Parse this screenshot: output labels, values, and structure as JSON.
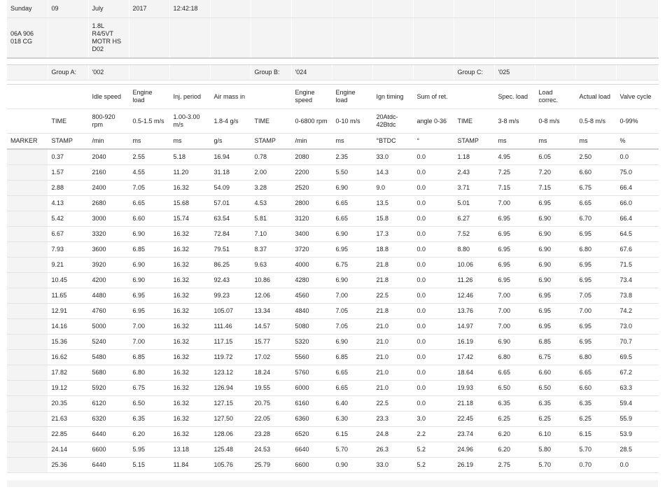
{
  "date_row": {
    "day": "Sunday",
    "date": "09",
    "month": "July",
    "year": "2017",
    "time": "12:42:18"
  },
  "part_row": {
    "part_number": "06A 906\n018 CG",
    "engine": "1.8L\nR4/5VT\nMOTR HS\nD02"
  },
  "groups": {
    "a_label": "Group A:",
    "a_value": "'002",
    "b_label": "Group B:",
    "b_value": "'024",
    "c_label": "Group C:",
    "c_value": "'025"
  },
  "columns": [
    {
      "name": "",
      "spec": "",
      "unit": "MARKER"
    },
    {
      "name": "",
      "spec": "TIME",
      "unit": "STAMP"
    },
    {
      "name": "Idle speed",
      "spec": "800-920\nrpm",
      "unit": "/min"
    },
    {
      "name": "Engine load",
      "spec": "0.5-1.5 m/s",
      "unit": "ms"
    },
    {
      "name": "Inj. period",
      "spec": "1.00-3.00\nm/s",
      "unit": "ms"
    },
    {
      "name": "Air mass in",
      "spec": "1.8-4 g/s",
      "unit": "g/s"
    },
    {
      "name": "",
      "spec": "TIME",
      "unit": "STAMP"
    },
    {
      "name": "Engine\nspeed",
      "spec": "0-6800 rpm",
      "unit": "/min"
    },
    {
      "name": "Engine load",
      "spec": "0-10 m/s",
      "unit": "ms"
    },
    {
      "name": "Ign timing",
      "spec": "20Atdc-\n42Btdc",
      "unit": "°BTDC"
    },
    {
      "name": "Sum of ret.",
      "spec": "angle 0-36",
      "unit": "°"
    },
    {
      "name": "",
      "spec": "TIME",
      "unit": "STAMP"
    },
    {
      "name": "Spec. load",
      "spec": "3-8 m/s",
      "unit": "ms"
    },
    {
      "name": "Load\ncorrec.",
      "spec": "0-8 m/s",
      "unit": "ms"
    },
    {
      "name": "Actual load",
      "spec": "0.5-8 m/s",
      "unit": "ms"
    },
    {
      "name": "Valve cycle",
      "spec": "0-99%",
      "unit": "%"
    }
  ],
  "rows": [
    [
      "",
      "0.37",
      "2040",
      "2.55",
      "5.18",
      "16.94",
      "0.78",
      "2080",
      "2.35",
      "33.0",
      "0.0",
      "1.18",
      "4.95",
      "6.05",
      "2.50",
      "0.0"
    ],
    [
      "",
      "1.57",
      "2160",
      "4.55",
      "11.20",
      "31.18",
      "2.00",
      "2200",
      "5.50",
      "14.3",
      "0.0",
      "2.43",
      "7.25",
      "7.20",
      "6.60",
      "75.0"
    ],
    [
      "",
      "2.88",
      "2400",
      "7.05",
      "16.32",
      "54.09",
      "3.28",
      "2520",
      "6.90",
      "9.0",
      "0.0",
      "3.71",
      "7.15",
      "7.15",
      "6.75",
      "66.4"
    ],
    [
      "",
      "4.13",
      "2680",
      "6.65",
      "15.68",
      "57.01",
      "4.53",
      "2800",
      "6.65",
      "13.5",
      "0.0",
      "5.01",
      "7.00",
      "6.95",
      "6.65",
      "66.0"
    ],
    [
      "",
      "5.42",
      "3000",
      "6.60",
      "15.74",
      "63.54",
      "5.81",
      "3120",
      "6.65",
      "15.8",
      "0.0",
      "6.27",
      "6.95",
      "6.90",
      "6.70",
      "66.4"
    ],
    [
      "",
      "6.67",
      "3320",
      "6.90",
      "16.32",
      "72.84",
      "7.10",
      "3400",
      "6.90",
      "17.3",
      "0.0",
      "7.52",
      "6.95",
      "6.90",
      "6.95",
      "64.5"
    ],
    [
      "",
      "7.93",
      "3600",
      "6.85",
      "16.32",
      "79.51",
      "8.37",
      "3720",
      "6.95",
      "18.8",
      "0.0",
      "8.80",
      "6.95",
      "6.90",
      "6.80",
      "67.6"
    ],
    [
      "",
      "9.21",
      "3920",
      "6.90",
      "16.32",
      "86.25",
      "9.63",
      "4000",
      "6.75",
      "21.8",
      "0.0",
      "10.06",
      "6.95",
      "6.90",
      "6.95",
      "71.5"
    ],
    [
      "",
      "10.45",
      "4200",
      "6.90",
      "16.32",
      "92.43",
      "10.86",
      "4280",
      "6.90",
      "21.8",
      "0.0",
      "11.26",
      "6.95",
      "6.90",
      "6.95",
      "73.4"
    ],
    [
      "",
      "11.65",
      "4480",
      "6.95",
      "16.32",
      "99.23",
      "12.06",
      "4560",
      "7.00",
      "22.5",
      "0.0",
      "12.46",
      "7.00",
      "6.95",
      "7.05",
      "73.8"
    ],
    [
      "",
      "12.91",
      "4760",
      "6.95",
      "16.32",
      "105.07",
      "13.34",
      "4840",
      "7.05",
      "21.8",
      "0.0",
      "13.76",
      "7.00",
      "6.95",
      "7.00",
      "74.2"
    ],
    [
      "",
      "14.16",
      "5000",
      "7.00",
      "16.32",
      "111.46",
      "14.57",
      "5080",
      "7.05",
      "21.0",
      "0.0",
      "14.97",
      "7.00",
      "6.95",
      "6.95",
      "73.0"
    ],
    [
      "",
      "15.36",
      "5240",
      "7.00",
      "16.32",
      "117.15",
      "15.77",
      "5320",
      "6.90",
      "21.0",
      "0.0",
      "16.19",
      "6.90",
      "6.85",
      "6.95",
      "70.7"
    ],
    [
      "",
      "16.62",
      "5480",
      "6.85",
      "16.32",
      "119.72",
      "17.02",
      "5560",
      "6.85",
      "21.0",
      "0.0",
      "17.42",
      "6.80",
      "6.75",
      "6.80",
      "69.5"
    ],
    [
      "",
      "17.82",
      "5680",
      "6.80",
      "16.32",
      "123.12",
      "18.24",
      "5760",
      "6.65",
      "21.0",
      "0.0",
      "18.64",
      "6.65",
      "6.60",
      "6.65",
      "67.2"
    ],
    [
      "",
      "19.12",
      "5920",
      "6.75",
      "16.32",
      "126.94",
      "19.55",
      "6000",
      "6.65",
      "21.0",
      "0.0",
      "19.93",
      "6.50",
      "6.50",
      "6.60",
      "63.3"
    ],
    [
      "",
      "20.35",
      "6120",
      "6.50",
      "16.32",
      "127.15",
      "20.75",
      "6160",
      "6.40",
      "22.5",
      "0.0",
      "21.18",
      "6.35",
      "6.35",
      "6.35",
      "59.4"
    ],
    [
      "",
      "21.63",
      "6320",
      "6.35",
      "16.32",
      "127.50",
      "22.05",
      "6360",
      "6.30",
      "23.3",
      "3.0",
      "22.45",
      "6.25",
      "6.25",
      "6.25",
      "55.9"
    ],
    [
      "",
      "22.85",
      "6440",
      "6.20",
      "16.32",
      "128.06",
      "23.28",
      "6520",
      "6.15",
      "24.8",
      "2.2",
      "23.74",
      "6.20",
      "6.10",
      "6.15",
      "53.9"
    ],
    [
      "",
      "24.14",
      "6600",
      "5.95",
      "13.18",
      "125.48",
      "24.53",
      "6640",
      "5.70",
      "26.3",
      "5.2",
      "24.96",
      "6.20",
      "5.80",
      "5.70",
      "28.5"
    ],
    [
      "",
      "25.36",
      "6440",
      "5.15",
      "11.84",
      "105.76",
      "25.79",
      "6600",
      "0.90",
      "33.0",
      "5.2",
      "26.19",
      "2.75",
      "5.70",
      "0.70",
      "0.0"
    ]
  ]
}
